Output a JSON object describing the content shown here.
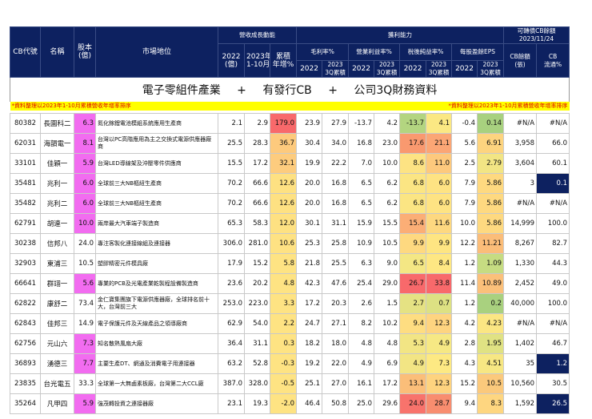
{
  "title": {
    "part1": "電子零組件產業",
    "plus1": "+",
    "part2": "有發行CB",
    "plus2": "+",
    "part3": "公司3Q財務資料"
  },
  "header": {
    "cb_code": "CB代號",
    "name": "名稱",
    "capital": "股本",
    "capital_unit": "(億)",
    "market": "市場地位",
    "revenue_group": "營收成長動能",
    "rev2022": "2022",
    "rev2022_unit": "(億)",
    "rev2023": "2023年",
    "rev2023_unit": "1-10月",
    "yoy": "累積",
    "yoy_unit": "年增%",
    "profit_group": "獲利能力",
    "gross": "毛利率%",
    "operating": "營業利益率%",
    "net": "稅後純益率%",
    "eps": "每股盈餘EPS",
    "y2022": "2022",
    "y2023": "2023",
    "q3": "3Q累積",
    "cb_group": "可轉債CB餘額",
    "cb_date": "2023/11/24",
    "cb_balance": "CB餘額",
    "cb_balance_unit": "(張)",
    "cb_float": "CB",
    "cb_float_unit": "流通%"
  },
  "note_left": "*資料整理以2023年1-10月累積營收年增率排序",
  "note_right": "*資料整理以2023年1-10月累積營收年增率排序",
  "colors": {
    "header": "#0d2160",
    "capital_highlight": "#f26cf0",
    "note_bg": "#ffff00",
    "note_text": "#e00000"
  },
  "rows": [
    {
      "v": [
        "80382",
        "長園科二",
        "6.3",
        "氮化鎵鋰電池模組系統應用生產商",
        "2.1",
        "2.9",
        "179.0",
        "23.9",
        "27.9",
        "-13.7",
        "4.2",
        "-13.7",
        "4.1",
        "-0.4",
        "0.14",
        "#N/A",
        "#N/A"
      ],
      "hl": true,
      "navy": false,
      "bg": [
        "#f8696b",
        "#b3d580",
        "#fbe883",
        "#a8d17f"
      ]
    },
    {
      "v": [
        "62031",
        "海韻電一",
        "8.1",
        "台灣以PC高階應用為主之交換式電源供應器廠商",
        "25.5",
        "28.3",
        "36.7",
        "30.4",
        "34.0",
        "16.8",
        "23.0",
        "17.6",
        "21.1",
        "5.6",
        "6.91",
        "3,958",
        "66.0"
      ],
      "hl": true,
      "navy": false,
      "bg": [
        "#fdca7d",
        "#f9996f",
        "#fba675",
        "#fdd47f"
      ]
    },
    {
      "v": [
        "33101",
        "佳穎一",
        "5.9",
        "台灣LED導線架及沖壓零件供應商",
        "15.5",
        "17.2",
        "32.1",
        "19.9",
        "22.2",
        "7.0",
        "10.0",
        "8.6",
        "11.0",
        "2.5",
        "2.79",
        "3,604",
        "60.1"
      ],
      "hl": true,
      "navy": false,
      "bg": [
        "#fdcc7e",
        "#fde383",
        "#fdc97d",
        "#f2e584"
      ]
    },
    {
      "v": [
        "35481",
        "兆利一",
        "6.0",
        "全球前三大NB樞紐生產商",
        "70.2",
        "66.6",
        "12.6",
        "20.0",
        "16.8",
        "6.5",
        "6.2",
        "6.8",
        "6.0",
        "7.9",
        "5.86",
        "3",
        "0.1"
      ],
      "hl": true,
      "navy": true,
      "bg": [
        "#fee182",
        "#fbe583",
        "#fee383",
        "#fed980"
      ]
    },
    {
      "v": [
        "35482",
        "兆利二",
        "6.0",
        "全球前三大NB樞紐生產商",
        "70.2",
        "66.6",
        "12.6",
        "20.0",
        "16.8",
        "6.5",
        "6.2",
        "6.8",
        "6.0",
        "7.9",
        "5.86",
        "#N/A",
        "#N/A"
      ],
      "hl": true,
      "navy": false,
      "bg": [
        "#fee182",
        "#fbe583",
        "#fee383",
        "#fed980"
      ]
    },
    {
      "v": [
        "62791",
        "胡連一",
        "10.0",
        "兩岸最大汽車端子製造商",
        "65.3",
        "58.3",
        "12.0",
        "30.1",
        "31.1",
        "15.9",
        "15.5",
        "15.4",
        "11.6",
        "10.0",
        "5.86",
        "14,999",
        "100.0"
      ],
      "hl": true,
      "navy": false,
      "bg": [
        "#fee182",
        "#fbae76",
        "#fdd880",
        "#fed980"
      ]
    },
    {
      "v": [
        "30238",
        "信邦八",
        "24.0",
        "專注客製化連接線組及連接器",
        "306.0",
        "281.0",
        "10.6",
        "25.3",
        "25.8",
        "10.9",
        "10.5",
        "9.9",
        "9.9",
        "12.2",
        "11.21",
        "8,267",
        "82.7"
      ],
      "hl": false,
      "navy": false,
      "bg": [
        "#fee283",
        "#fed980",
        "#fee582",
        "#fbbd79"
      ]
    },
    {
      "v": [
        "32903",
        "東浦三",
        "10.5",
        "塑膠精密元件模具廠",
        "17.9",
        "15.2",
        "5.8",
        "21.8",
        "25.5",
        "6.3",
        "9.0",
        "6.5",
        "8.4",
        "1.2",
        "1.09",
        "1,330",
        "44.3"
      ],
      "hl": false,
      "navy": false,
      "bg": [
        "#fee383",
        "#f4e784",
        "#fee783",
        "#c6dc82"
      ]
    },
    {
      "v": [
        "66641",
        "群翊一",
        "5.6",
        "專業的PCB及光電產業乾製程設備製造商",
        "23.6",
        "20.2",
        "4.8",
        "42.3",
        "47.6",
        "25.4",
        "29.0",
        "26.7",
        "33.8",
        "11.4",
        "10.89",
        "2,452",
        "49.0"
      ],
      "hl": true,
      "navy": false,
      "bg": [
        "#fee383",
        "#f8696b",
        "#f8696b",
        "#fbc07a"
      ]
    },
    {
      "v": [
        "62822",
        "康舒二",
        "73.4",
        "金仁寶集團旗下電源供應器廠，全球排名前十大，台灣前三大",
        "253.0",
        "223.0",
        "3.3",
        "17.2",
        "20.3",
        "2.6",
        "1.5",
        "2.7",
        "0.7",
        "1.2",
        "0.2",
        "40,000",
        "100.0"
      ],
      "hl": false,
      "navy": false,
      "bg": [
        "#fee383",
        "#e5e283",
        "#dde183",
        "#a9d17f"
      ]
    },
    {
      "v": [
        "62843",
        "佳邦三",
        "14.9",
        "電子保護元件及天線產品之領導廠商",
        "62.9",
        "54.0",
        "2.2",
        "24.7",
        "27.1",
        "8.2",
        "10.2",
        "9.4",
        "12.3",
        "4.2",
        "4.23",
        "#N/A",
        "#N/A"
      ],
      "hl": false,
      "navy": false,
      "bg": [
        "#fee383",
        "#fedd81",
        "#fed480",
        "#fbe683"
      ]
    },
    {
      "v": [
        "62756",
        "元山六",
        "7.3",
        "知名散熱風扇大廠",
        "36.4",
        "31.1",
        "0.3",
        "18.2",
        "18.0",
        "4.8",
        "4.8",
        "5.3",
        "4.9",
        "2.8",
        "1.95",
        "1,402",
        "46.7"
      ],
      "hl": true,
      "navy": false,
      "bg": [
        "#fee383",
        "#f2e584",
        "#f6e884",
        "#e0e283"
      ]
    },
    {
      "v": [
        "36893",
        "湧德三",
        "7.7",
        "主要生產DT、網通及消費電子用連接器",
        "63.2",
        "52.8",
        "-0.3",
        "19.2",
        "22.0",
        "4.9",
        "6.9",
        "4.9",
        "7.3",
        "4.3",
        "4.51",
        "35",
        "1.2"
      ],
      "hl": true,
      "navy": true,
      "bg": [
        "#fee383",
        "#f2e584",
        "#fde983",
        "#f7e783"
      ]
    },
    {
      "v": [
        "23835",
        "台光電五",
        "33.3",
        "全球第一大無鹵素板廠，台灣第二大CCL廠",
        "387.0",
        "328.0",
        "-0.5",
        "25.1",
        "27.0",
        "16.1",
        "17.2",
        "13.1",
        "12.3",
        "15.2",
        "10.5",
        "10,560",
        "30.5"
      ],
      "hl": false,
      "navy": false,
      "bg": [
        "#fee383",
        "#fbbe79",
        "#fed37f",
        "#fbc97c"
      ]
    },
    {
      "v": [
        "35264",
        "凡甲四",
        "5.9",
        "強茂轉投資之連接器廠",
        "23.1",
        "19.3",
        "-2.0",
        "46.4",
        "50.8",
        "25.0",
        "29.6",
        "24.0",
        "28.7",
        "9.4",
        "8.3",
        "1,592",
        "26.5"
      ],
      "hl": true,
      "navy": true,
      "bg": [
        "#fee383",
        "#f8736c",
        "#f88d6f",
        "#fed680"
      ]
    }
  ]
}
